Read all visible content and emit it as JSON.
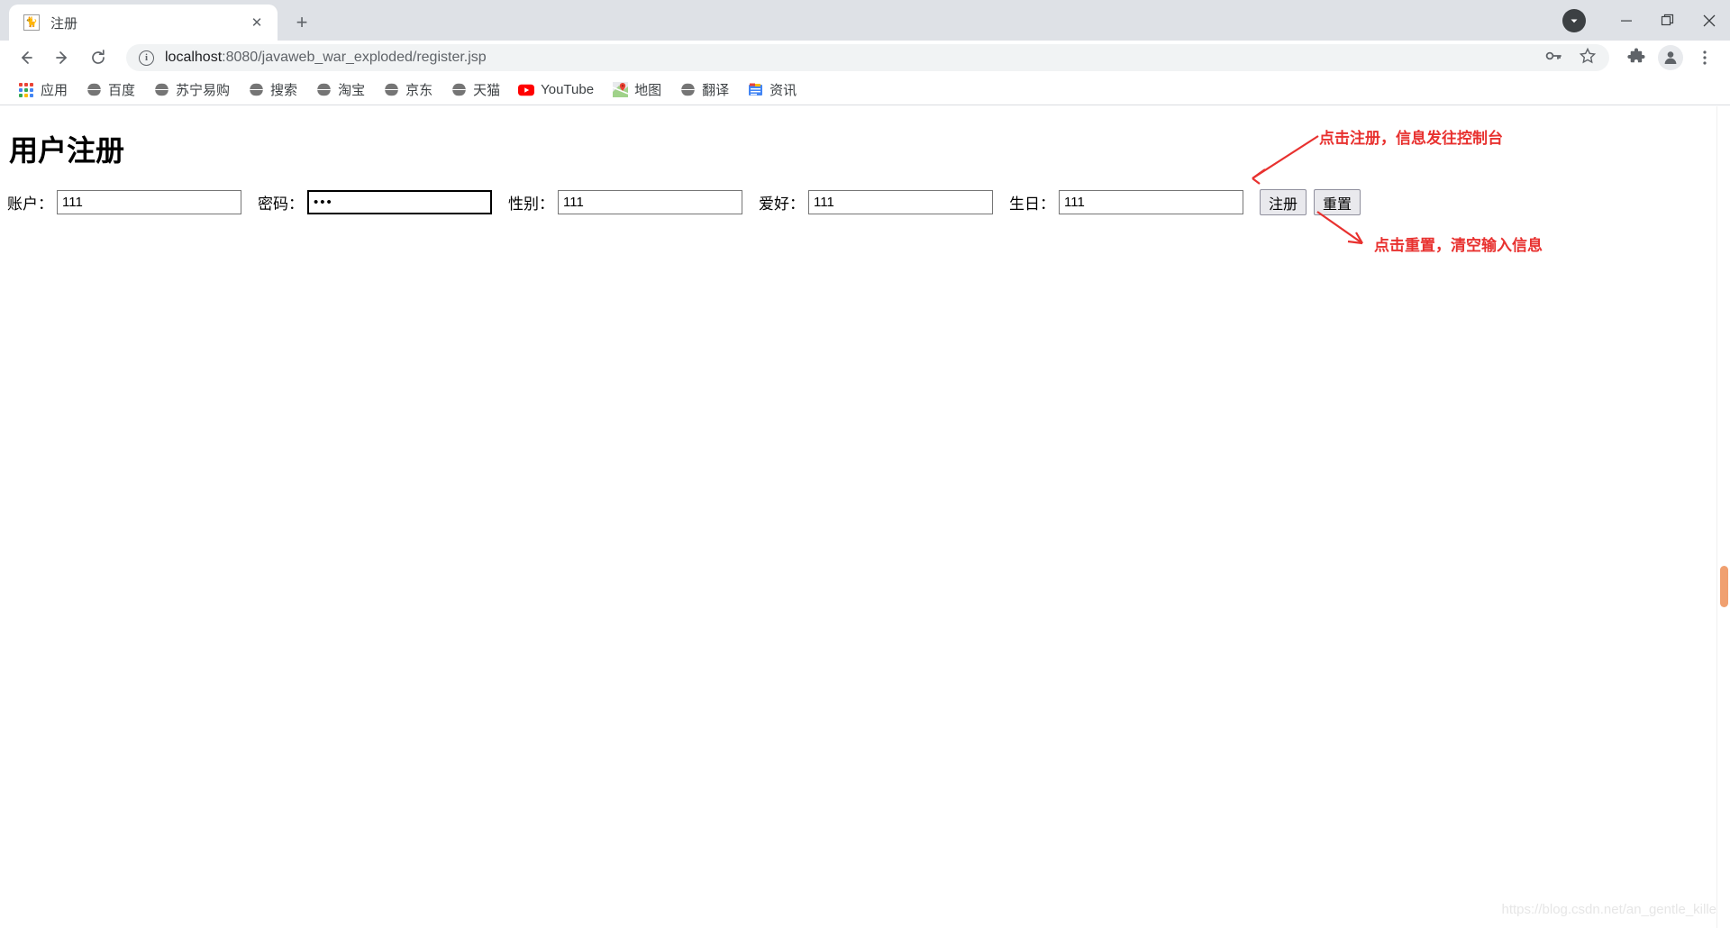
{
  "browser": {
    "tab": {
      "title": "注册",
      "favicon": "tomcat-cat-icon",
      "close_label": "✕"
    },
    "newtab_label": "+",
    "window_controls": {
      "download_label": "▼",
      "minimize_label": "—",
      "restore_label": "❐",
      "close_label": "✕"
    },
    "nav": {
      "back_label": "←",
      "forward_label": "→",
      "reload_label": "⟳"
    },
    "omnibox": {
      "info_label": "i",
      "url_host": "localhost",
      "url_path": ":8080/javaweb_war_exploded/register.jsp",
      "key_icon": "password-key-icon",
      "star_icon": "bookmark-star-icon"
    },
    "toolbar_icons": {
      "extensions": "puzzle-piece-icon",
      "profile": "user-avatar-icon",
      "menu": "three-dot-menu-icon"
    },
    "bookmarks": [
      {
        "label": "应用",
        "icon": "apps-grid-icon"
      },
      {
        "label": "百度",
        "icon": "globe-icon"
      },
      {
        "label": "苏宁易购",
        "icon": "globe-icon"
      },
      {
        "label": "搜索",
        "icon": "globe-icon"
      },
      {
        "label": "淘宝",
        "icon": "globe-icon"
      },
      {
        "label": "京东",
        "icon": "globe-icon"
      },
      {
        "label": "天猫",
        "icon": "globe-icon"
      },
      {
        "label": "YouTube",
        "icon": "youtube-icon"
      },
      {
        "label": "地图",
        "icon": "google-maps-icon"
      },
      {
        "label": "翻译",
        "icon": "globe-icon"
      },
      {
        "label": "资讯",
        "icon": "google-news-icon"
      }
    ]
  },
  "page": {
    "heading": "用户注册",
    "fields": [
      {
        "label": "账户：",
        "value": "111",
        "type": "text",
        "focused": false
      },
      {
        "label": "密码：",
        "value": "•••",
        "type": "password",
        "focused": true
      },
      {
        "label": "性别：",
        "value": "111",
        "type": "text",
        "focused": false
      },
      {
        "label": "爱好：",
        "value": "111",
        "type": "text",
        "focused": false
      },
      {
        "label": "生日：",
        "value": "111",
        "type": "text",
        "focused": false
      }
    ],
    "buttons": [
      {
        "label": "注册",
        "name": "register-button"
      },
      {
        "label": "重置",
        "name": "reset-button"
      }
    ],
    "annotations": [
      {
        "text": "点击注册，信息发往控制台",
        "color": "#e8312f"
      },
      {
        "text": "点击重置，清空输入信息",
        "color": "#e8312f"
      }
    ],
    "watermark": "https://blog.csdn.net/an_gentle_killer"
  }
}
